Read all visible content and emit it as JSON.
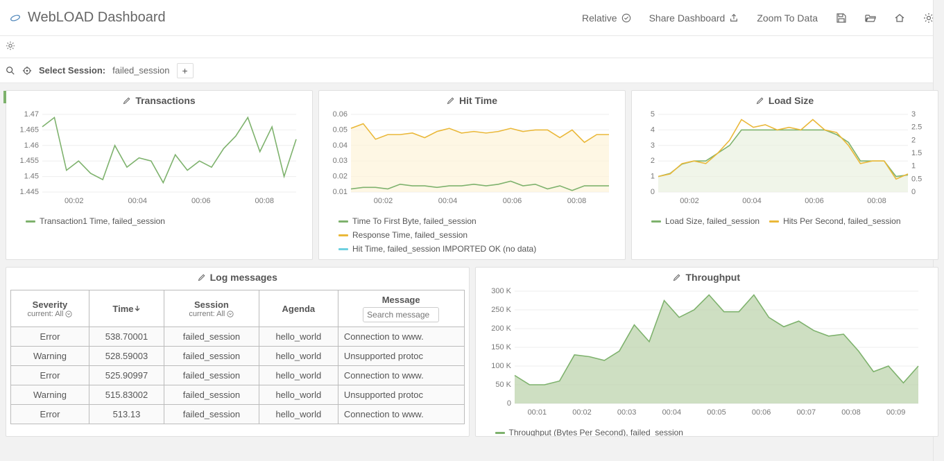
{
  "header": {
    "title": "WebLOAD Dashboard",
    "actions": {
      "relative": "Relative",
      "share": "Share Dashboard",
      "zoom": "Zoom To Data"
    }
  },
  "sessionbar": {
    "select_label": "Select Session:",
    "session_name": "failed_session"
  },
  "panels": {
    "transactions": {
      "title": "Transactions",
      "legend1": "Transaction1 Time, failed_session"
    },
    "hit_time": {
      "title": "Hit Time",
      "legend1": "Time To First Byte, failed_session",
      "legend2": "Response Time, failed_session",
      "legend3": "Hit Time, failed_session IMPORTED OK (no data)"
    },
    "load_size": {
      "title": "Load Size",
      "legend1": "Load Size, failed_session",
      "legend2": "Hits Per Second, failed_session"
    },
    "log": {
      "title": "Log messages",
      "headers": {
        "severity": "Severity",
        "severity_sub": "current: All",
        "time": "Time",
        "session": "Session",
        "session_sub": "current: All",
        "agenda": "Agenda",
        "message": "Message",
        "search_placeholder": "Search message"
      },
      "rows": [
        {
          "sev": "Error",
          "time": "538.70001",
          "session": "failed_session",
          "agenda": "hello_world",
          "msg": "Connection to www."
        },
        {
          "sev": "Warning",
          "time": "528.59003",
          "session": "failed_session",
          "agenda": "hello_world",
          "msg": "Unsupported protoc"
        },
        {
          "sev": "Error",
          "time": "525.90997",
          "session": "failed_session",
          "agenda": "hello_world",
          "msg": "Connection to www."
        },
        {
          "sev": "Warning",
          "time": "515.83002",
          "session": "failed_session",
          "agenda": "hello_world",
          "msg": "Unsupported protoc"
        },
        {
          "sev": "Error",
          "time": "513.13",
          "session": "failed_session",
          "agenda": "hello_world",
          "msg": "Connection to www."
        }
      ]
    },
    "throughput": {
      "title": "Throughput",
      "legend1": "Throughput (Bytes Per Second), failed_session"
    }
  },
  "chart_data": [
    {
      "id": "transactions",
      "type": "line",
      "title": "Transactions",
      "x_ticks": [
        "00:02",
        "00:04",
        "00:06",
        "00:08"
      ],
      "y_ticks": [
        1.445,
        1.45,
        1.455,
        1.46,
        1.465,
        1.47
      ],
      "ylim": [
        1.445,
        1.47
      ],
      "series": [
        {
          "name": "Transaction1 Time, failed_session",
          "color": "#7eb26d",
          "values": [
            1.466,
            1.469,
            1.452,
            1.455,
            1.451,
            1.449,
            1.46,
            1.453,
            1.456,
            1.455,
            1.448,
            1.457,
            1.452,
            1.455,
            1.453,
            1.459,
            1.463,
            1.469,
            1.458,
            1.466,
            1.45,
            1.462
          ]
        }
      ]
    },
    {
      "id": "hit_time",
      "type": "line",
      "title": "Hit Time",
      "x_ticks": [
        "00:02",
        "00:04",
        "00:06",
        "00:08"
      ],
      "y_ticks": [
        0.01,
        0.02,
        0.03,
        0.04,
        0.05,
        0.06
      ],
      "ylim": [
        0.01,
        0.06
      ],
      "series": [
        {
          "name": "Response Time, failed_session",
          "color": "#eab839",
          "fill": "#fdf3d9",
          "values": [
            0.051,
            0.054,
            0.044,
            0.047,
            0.047,
            0.048,
            0.045,
            0.049,
            0.051,
            0.048,
            0.049,
            0.048,
            0.049,
            0.051,
            0.049,
            0.05,
            0.05,
            0.045,
            0.05,
            0.042,
            0.047,
            0.047
          ]
        },
        {
          "name": "Time To First Byte, failed_session",
          "color": "#7eb26d",
          "values": [
            0.012,
            0.013,
            0.013,
            0.012,
            0.015,
            0.014,
            0.014,
            0.013,
            0.014,
            0.014,
            0.015,
            0.014,
            0.015,
            0.017,
            0.014,
            0.015,
            0.012,
            0.014,
            0.011,
            0.014,
            0.014,
            0.014
          ]
        },
        {
          "name": "Hit Time, failed_session IMPORTED OK (no data)",
          "color": "#6ed0e0",
          "values": []
        }
      ]
    },
    {
      "id": "load_size",
      "type": "line",
      "title": "Load Size",
      "x_ticks": [
        "00:02",
        "00:04",
        "00:06",
        "00:08"
      ],
      "y_left_ticks": [
        0,
        1.0,
        2.0,
        3.0,
        4.0,
        5.0
      ],
      "y_right_ticks": [
        0,
        0.5,
        1.0,
        1.5,
        2.0,
        2.5,
        3.0
      ],
      "series": [
        {
          "name": "Load Size, failed_session",
          "axis": "left",
          "color": "#7eb26d",
          "fill": "#e9f1df",
          "values": [
            1.0,
            1.2,
            1.8,
            2.0,
            2.0,
            2.5,
            3.0,
            4.0,
            4.0,
            4.0,
            4.0,
            4.0,
            4.0,
            4.0,
            4.0,
            3.7,
            3.2,
            2.0,
            2.0,
            2.0,
            1.0,
            1.1
          ]
        },
        {
          "name": "Hits Per Second, failed_session",
          "axis": "right",
          "color": "#eab839",
          "values": [
            0.6,
            0.7,
            1.1,
            1.2,
            1.1,
            1.5,
            2.0,
            2.8,
            2.5,
            2.6,
            2.4,
            2.5,
            2.4,
            2.8,
            2.4,
            2.3,
            1.8,
            1.1,
            1.2,
            1.2,
            0.5,
            0.7
          ]
        }
      ]
    },
    {
      "id": "throughput",
      "type": "area",
      "title": "Throughput",
      "x_ticks": [
        "00:01",
        "00:02",
        "00:03",
        "00:04",
        "00:05",
        "00:06",
        "00:07",
        "00:08",
        "00:09"
      ],
      "y_ticks": [
        "0",
        "50 K",
        "100 K",
        "150 K",
        "200 K",
        "250 K",
        "300 K"
      ],
      "ylim": [
        0,
        300000
      ],
      "series": [
        {
          "name": "Throughput (Bytes Per Second), failed_session",
          "color": "#7eb26d",
          "fill": "#b9d2a8",
          "values": [
            75000,
            50000,
            50000,
            60000,
            130000,
            125000,
            115000,
            140000,
            210000,
            165000,
            275000,
            230000,
            250000,
            290000,
            245000,
            245000,
            290000,
            230000,
            205000,
            220000,
            195000,
            180000,
            185000,
            140000,
            85000,
            100000,
            55000,
            100000
          ]
        }
      ]
    }
  ],
  "colors": {
    "green": "#7eb26d",
    "yellow": "#eab839",
    "cyan": "#6ed0e0"
  }
}
